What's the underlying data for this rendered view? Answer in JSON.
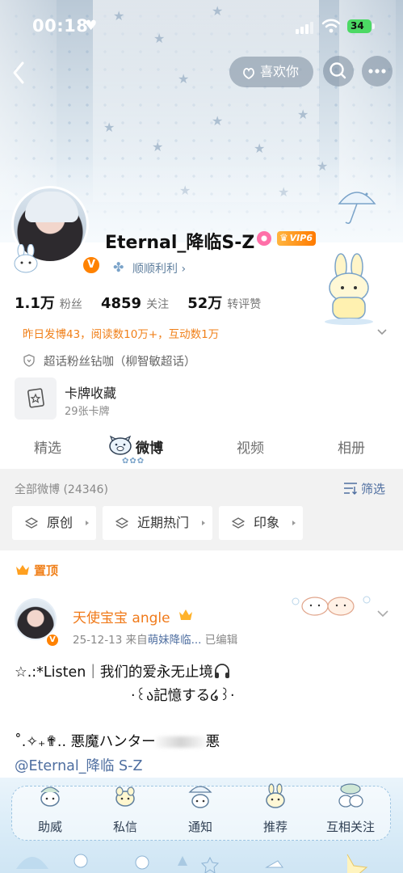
{
  "status_bar": {
    "time": "00:18",
    "battery": "34"
  },
  "nav": {
    "like_label": "喜欢你"
  },
  "profile": {
    "username": "Eternal_降临S-Z",
    "vip_level": "VIP6",
    "lucky_label": "顺顺利利",
    "stats": [
      {
        "value": "1.1万",
        "label": "粉丝"
      },
      {
        "value": "4859",
        "label": "关注"
      },
      {
        "value": "52万",
        "label": "转评赞"
      }
    ],
    "daily_summary": "昨日发博43，阅读数10万+，互动数1万",
    "super_topic": "超话粉丝钻咖（柳智敏超话）",
    "card": {
      "title": "卡牌收藏",
      "subtitle": "29张卡牌"
    }
  },
  "tabs": [
    {
      "label": "精选",
      "active": false
    },
    {
      "label": "微博",
      "active": true
    },
    {
      "label": "视频",
      "active": false
    },
    {
      "label": "相册",
      "active": false
    }
  ],
  "feed": {
    "all_weibo": "全部微博 (24346)",
    "filter_label": "筛选",
    "chips": [
      "原创",
      "近期热门",
      "印象"
    ]
  },
  "post": {
    "pinned_label": "置顶",
    "author": "天使宝宝 angle",
    "date": "25-12-13",
    "source_prefix": "来自",
    "source": "萌妹降临...",
    "edited": "已编辑",
    "line1": "☆.:*Listen｜我们的爱永无止境",
    "line2": "·꒰ა記憶する໒꒱·",
    "line3_start": "˚.✧₊✟.. 悪魔ハンター",
    "line3_end": "悪",
    "mention": "@Eternal_降临 S-Z"
  },
  "bottom_bar": [
    "助威",
    "私信",
    "通知",
    "推荐",
    "互相关注"
  ],
  "colors": {
    "orange": "#f07a1a",
    "blue_link": "#4e6ea0",
    "vip": "#ff8200"
  }
}
